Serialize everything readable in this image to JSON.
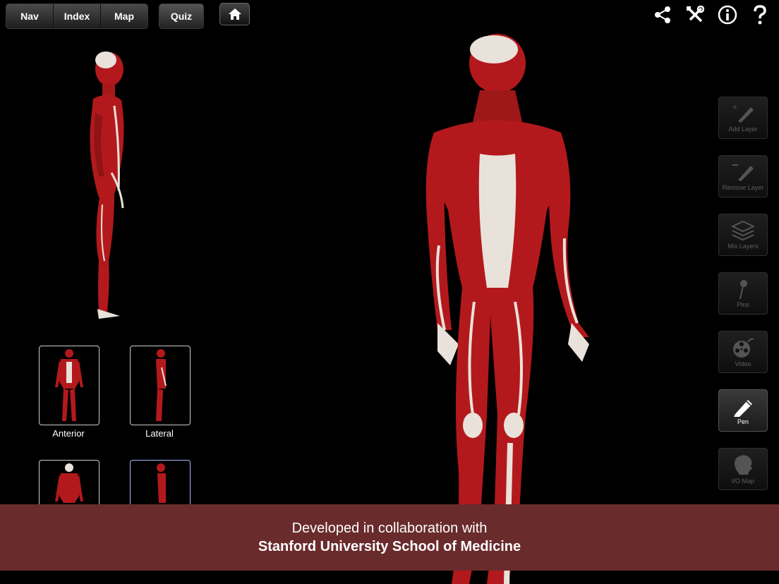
{
  "nav": {
    "tabs": [
      {
        "label": "Nav"
      },
      {
        "label": "Index"
      },
      {
        "label": "Map"
      }
    ],
    "quiz_label": "Quiz",
    "home_icon": "home-icon"
  },
  "top_icons": [
    "share-icon",
    "settings-tools-icon",
    "info-icon",
    "help-icon"
  ],
  "views": {
    "thumbnails": [
      {
        "label": "Anterior",
        "selected": false
      },
      {
        "label": "Lateral",
        "selected": false
      },
      {
        "label": "",
        "selected": false
      },
      {
        "label": "",
        "selected": true
      }
    ]
  },
  "tools": [
    {
      "label": "Add Layer",
      "icon": "add-layer-icon",
      "enabled": false
    },
    {
      "label": "Remove Layer",
      "icon": "remove-layer-icon",
      "enabled": false
    },
    {
      "label": "Mix Layers",
      "icon": "layers-icon",
      "enabled": false
    },
    {
      "label": "Pins",
      "icon": "pin-icon",
      "enabled": false
    },
    {
      "label": "Video",
      "icon": "video-reel-icon",
      "enabled": false
    },
    {
      "label": "Pen",
      "icon": "pen-icon",
      "enabled": true
    },
    {
      "label": "I/O Map",
      "icon": "head-map-icon",
      "enabled": false
    }
  ],
  "banner": {
    "line1": "Developed in collaboration with",
    "line2": "Stanford University School of Medicine"
  },
  "colors": {
    "muscle": "#b3191c",
    "tendon": "#e9e2da",
    "banner": "#6a2b2d"
  }
}
